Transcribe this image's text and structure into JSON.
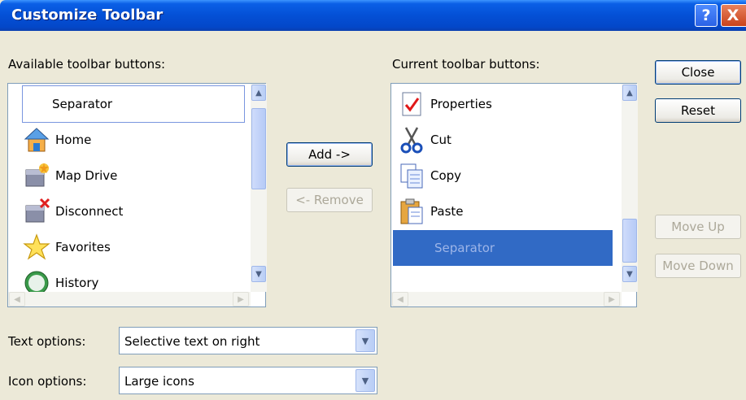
{
  "window": {
    "title": "Customize Toolbar",
    "help_label": "?",
    "close_label": "X"
  },
  "available": {
    "label": "Available toolbar buttons:",
    "items": [
      {
        "label": "Separator",
        "icon": "none",
        "focused": true
      },
      {
        "label": "Home",
        "icon": "home-icon"
      },
      {
        "label": "Map Drive",
        "icon": "map-drive-icon"
      },
      {
        "label": "Disconnect",
        "icon": "disconnect-icon"
      },
      {
        "label": "Favorites",
        "icon": "favorites-icon"
      },
      {
        "label": "History",
        "icon": "history-icon"
      }
    ]
  },
  "current": {
    "label": "Current toolbar buttons:",
    "items": [
      {
        "label": "Properties",
        "icon": "properties-icon"
      },
      {
        "label": "Cut",
        "icon": "cut-icon"
      },
      {
        "label": "Copy",
        "icon": "copy-icon"
      },
      {
        "label": "Paste",
        "icon": "paste-icon"
      },
      {
        "label": "Separator",
        "icon": "none",
        "selected": true
      }
    ]
  },
  "buttons": {
    "add": "Add ->",
    "remove": "<- Remove",
    "close": "Close",
    "reset": "Reset",
    "move_up": "Move Up",
    "move_down": "Move Down"
  },
  "text_options": {
    "label": "Text options:",
    "value": "Selective text on right"
  },
  "icon_options": {
    "label": "Icon options:",
    "value": "Large icons"
  },
  "colors": {
    "title_bar": "#0450d6",
    "selection": "#316ac5",
    "dialog_bg": "#ece9d8"
  }
}
